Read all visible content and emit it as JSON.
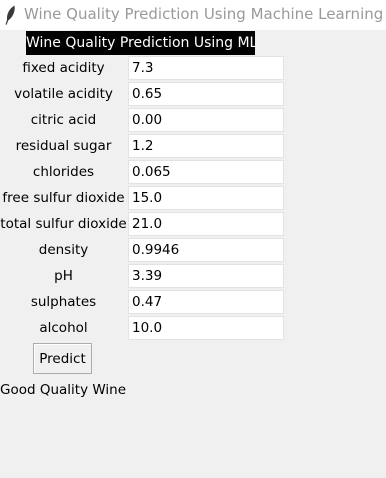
{
  "window": {
    "title": "Wine Quality Prediction Using Machine Learning",
    "icon": "feather-icon"
  },
  "heading": "Wine Quality Prediction Using ML",
  "fields": [
    {
      "label": "fixed acidity",
      "value": "7.3"
    },
    {
      "label": "volatile acidity",
      "value": "0.65"
    },
    {
      "label": "citric acid",
      "value": "0.00"
    },
    {
      "label": "residual sugar",
      "value": "1.2"
    },
    {
      "label": "chlorides",
      "value": "0.065"
    },
    {
      "label": "free sulfur dioxide",
      "value": "15.0"
    },
    {
      "label": "total sulfur dioxide",
      "value": "21.0"
    },
    {
      "label": "density",
      "value": "0.9946"
    },
    {
      "label": "pH",
      "value": "3.39"
    },
    {
      "label": "sulphates",
      "value": "0.47"
    },
    {
      "label": "alcohol",
      "value": "10.0"
    }
  ],
  "predict_button": "Predict",
  "result": "Good Quality Wine"
}
